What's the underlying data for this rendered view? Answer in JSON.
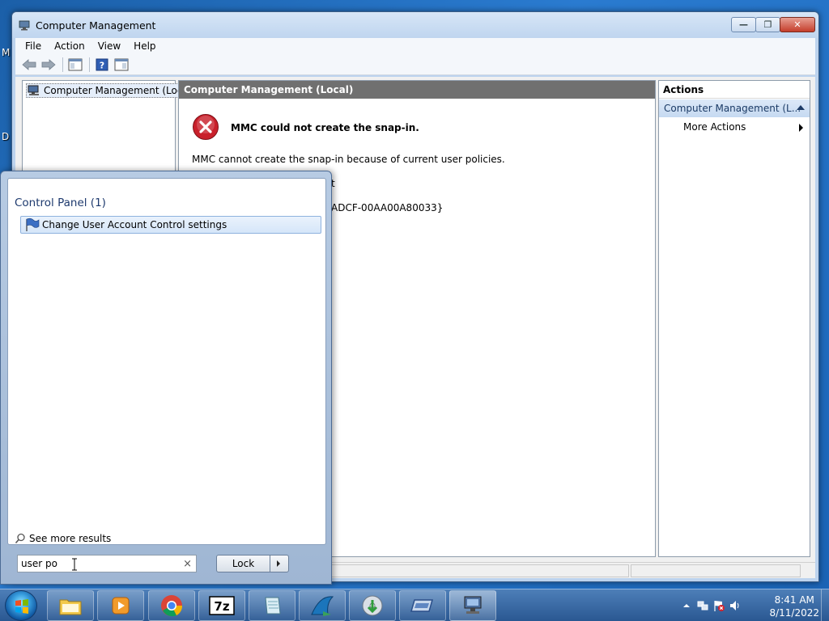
{
  "desktop": {
    "fragments": [
      "M",
      "D"
    ]
  },
  "window": {
    "title": "Computer Management",
    "menu": [
      "File",
      "Action",
      "View",
      "Help"
    ]
  },
  "tree": {
    "root_label": "Computer Management (Local"
  },
  "center": {
    "header": "Computer Management (Local)",
    "error_title": "MMC could not create the snap-in.",
    "error_message": "MMC cannot create the snap-in because of current user policies.",
    "fragment_1": "t",
    "fragment_2": "ADCF-00AA00A80033}"
  },
  "actions": {
    "header": "Actions",
    "section": "Computer Management (L...",
    "item": "More Actions"
  },
  "start_menu": {
    "category": "Control Panel (1)",
    "result": "Change User Account Control settings",
    "see_more": "See more results",
    "search_value": "user po",
    "lock_label": "Lock"
  },
  "taskbar": {
    "apps": [
      "windows-explorer",
      "media-player",
      "chrome",
      "7zip",
      "notepad",
      "wireshark",
      "installer",
      "virtual-drive",
      "computer-management"
    ],
    "time": "8:41 AM",
    "date": "8/11/2022"
  },
  "colors": {
    "error_red": "#c9202b",
    "pane_header_gray": "#707070",
    "section_blue": "#c5d9f1",
    "taskbar_blue": "#2a5892"
  }
}
